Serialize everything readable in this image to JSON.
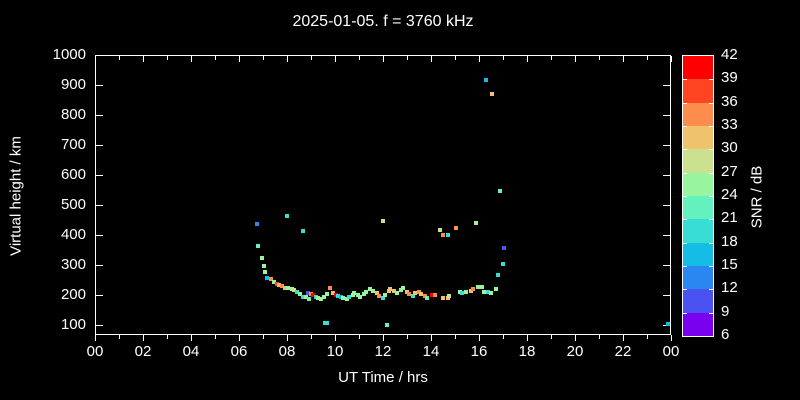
{
  "chart_data": {
    "type": "scatter",
    "title": "2025-01-05. f = 3760 kHz",
    "xlabel": "UT Time / hrs",
    "ylabel": "Virtual height / km",
    "xlim": [
      0,
      24
    ],
    "ylim": [
      100,
      1000
    ],
    "grid": false,
    "background": "#000000",
    "axis_color": "#ffffff",
    "xtick_hours": [
      0,
      2,
      4,
      6,
      8,
      10,
      12,
      14,
      16,
      18,
      20,
      22,
      24
    ],
    "xtick_labels": [
      "00",
      "02",
      "04",
      "06",
      "08",
      "10",
      "12",
      "14",
      "16",
      "18",
      "20",
      "22",
      "00"
    ],
    "ytick_values": [
      100,
      200,
      300,
      400,
      500,
      600,
      700,
      800,
      900,
      1000
    ],
    "ytick_labels": [
      "100",
      "200",
      "300",
      "400",
      "500",
      "600",
      "700",
      "800",
      "900",
      "1000"
    ],
    "colorbar": {
      "label": "SNR / dB",
      "min": 6,
      "max": 42,
      "step": 3,
      "tick_labels_top_to_bottom": [
        "42",
        "39",
        "36",
        "33",
        "30",
        "27",
        "24",
        "21",
        "18",
        "15",
        "12",
        "9",
        "6"
      ],
      "colors_top_to_bottom": [
        "#ff0000",
        "#ff4422",
        "#fc8d4c",
        "#efc36e",
        "#cce18f",
        "#98f49e",
        "#63f2bd",
        "#38ded4",
        "#15bde6",
        "#2a86f0",
        "#4b52f2",
        "#7a00f0"
      ]
    },
    "points_format": [
      "ut_hours",
      "virtual_height_km",
      "snr_db"
    ],
    "points": [
      [
        6.76,
        437,
        13
      ],
      [
        6.8,
        363,
        22
      ],
      [
        6.97,
        323,
        25
      ],
      [
        7.05,
        297,
        25
      ],
      [
        7.1,
        277,
        25
      ],
      [
        7.18,
        257,
        16
      ],
      [
        7.35,
        253,
        34
      ],
      [
        7.47,
        243,
        25
      ],
      [
        7.6,
        237,
        37
      ],
      [
        7.68,
        233,
        31
      ],
      [
        7.8,
        230,
        34
      ],
      [
        7.93,
        223,
        31
      ],
      [
        8.01,
        463,
        19
      ],
      [
        8.06,
        223,
        25
      ],
      [
        8.22,
        220,
        25
      ],
      [
        8.31,
        217,
        28
      ],
      [
        8.43,
        210,
        19
      ],
      [
        8.56,
        203,
        25
      ],
      [
        8.68,
        413,
        19
      ],
      [
        8.68,
        193,
        19
      ],
      [
        8.81,
        193,
        25
      ],
      [
        8.89,
        207,
        10
      ],
      [
        8.93,
        187,
        22
      ],
      [
        9.02,
        203,
        34
      ],
      [
        9.1,
        200,
        40
      ],
      [
        9.22,
        193,
        19
      ],
      [
        9.31,
        190,
        25
      ],
      [
        9.43,
        187,
        25
      ],
      [
        9.56,
        193,
        25
      ],
      [
        9.58,
        107,
        19
      ],
      [
        9.68,
        107,
        19
      ],
      [
        9.68,
        203,
        25
      ],
      [
        9.81,
        223,
        34
      ],
      [
        9.93,
        207,
        31
      ],
      [
        10.06,
        200,
        40
      ],
      [
        10.14,
        197,
        19
      ],
      [
        10.27,
        193,
        16
      ],
      [
        10.35,
        190,
        25
      ],
      [
        10.52,
        187,
        25
      ],
      [
        10.6,
        193,
        19
      ],
      [
        10.73,
        200,
        25
      ],
      [
        10.81,
        207,
        25
      ],
      [
        10.94,
        200,
        25
      ],
      [
        11.06,
        193,
        25
      ],
      [
        11.19,
        203,
        25
      ],
      [
        11.31,
        210,
        25
      ],
      [
        11.44,
        220,
        25
      ],
      [
        11.6,
        213,
        25
      ],
      [
        11.73,
        207,
        31
      ],
      [
        11.85,
        197,
        34
      ],
      [
        11.98,
        190,
        19
      ],
      [
        12.02,
        447,
        28
      ],
      [
        12.1,
        200,
        25
      ],
      [
        12.15,
        100,
        22
      ],
      [
        12.23,
        213,
        31
      ],
      [
        12.31,
        220,
        31
      ],
      [
        12.44,
        213,
        31
      ],
      [
        12.6,
        207,
        25
      ],
      [
        12.73,
        217,
        25
      ],
      [
        12.85,
        223,
        25
      ],
      [
        12.98,
        210,
        31
      ],
      [
        13.1,
        203,
        34
      ],
      [
        13.23,
        197,
        19
      ],
      [
        13.35,
        207,
        31
      ],
      [
        13.48,
        210,
        34
      ],
      [
        13.6,
        203,
        31
      ],
      [
        13.73,
        197,
        34
      ],
      [
        13.85,
        190,
        22
      ],
      [
        14.06,
        200,
        40
      ],
      [
        14.15,
        200,
        34
      ],
      [
        14.36,
        417,
        28
      ],
      [
        14.48,
        400,
        34
      ],
      [
        14.52,
        190,
        31
      ],
      [
        14.69,
        400,
        19
      ],
      [
        14.69,
        190,
        31
      ],
      [
        14.77,
        197,
        28
      ],
      [
        15.03,
        423,
        34
      ],
      [
        15.19,
        210,
        25
      ],
      [
        15.31,
        207,
        19
      ],
      [
        15.44,
        210,
        25
      ],
      [
        15.65,
        213,
        31
      ],
      [
        15.77,
        220,
        34
      ],
      [
        15.86,
        440,
        25
      ],
      [
        15.94,
        227,
        25
      ],
      [
        16.11,
        227,
        25
      ],
      [
        16.19,
        210,
        25
      ],
      [
        16.28,
        917,
        16
      ],
      [
        16.36,
        210,
        19
      ],
      [
        16.52,
        207,
        25
      ],
      [
        16.53,
        870,
        31
      ],
      [
        16.69,
        220,
        25
      ],
      [
        16.78,
        267,
        19
      ],
      [
        16.86,
        547,
        22
      ],
      [
        16.99,
        303,
        19
      ],
      [
        17.03,
        357,
        10
      ],
      [
        23.88,
        103,
        16
      ]
    ]
  }
}
